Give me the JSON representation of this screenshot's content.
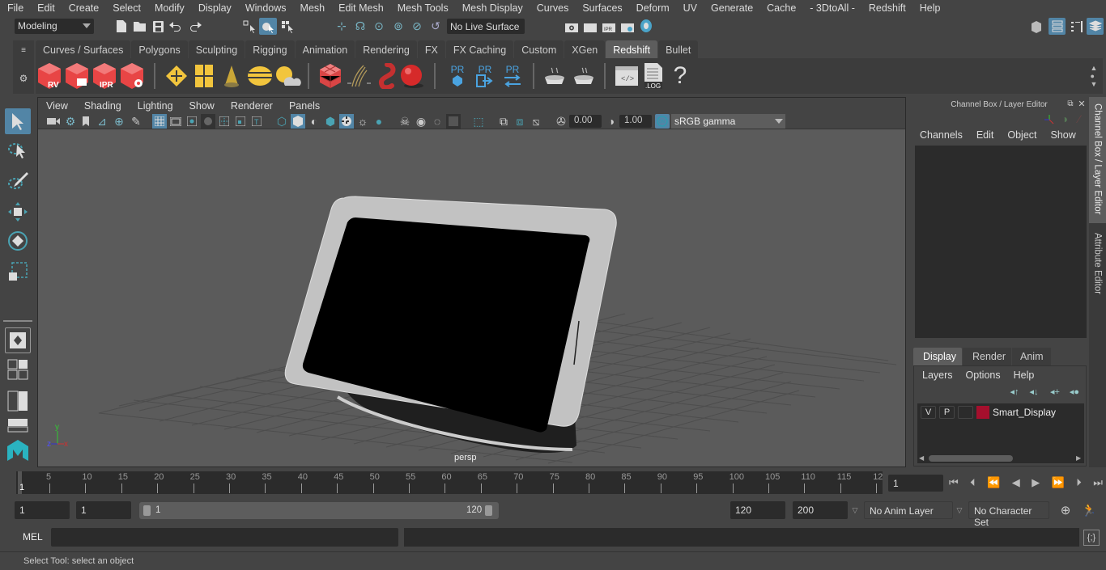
{
  "menu": [
    "File",
    "Edit",
    "Create",
    "Select",
    "Modify",
    "Display",
    "Windows",
    "Mesh",
    "Edit Mesh",
    "Mesh Tools",
    "Mesh Display",
    "Curves",
    "Surfaces",
    "Deform",
    "UV",
    "Generate",
    "Cache",
    "- 3DtoAll -",
    "Redshift",
    "Help"
  ],
  "status_line": {
    "mode": "Modeling",
    "live_surface": "No Live Surface"
  },
  "shelf": {
    "tabs": [
      "Curves / Surfaces",
      "Polygons",
      "Sculpting",
      "Rigging",
      "Animation",
      "Rendering",
      "FX",
      "FX Caching",
      "Custom",
      "XGen",
      "Redshift",
      "Bullet"
    ],
    "active_tab": "Redshift",
    "icons": [
      "rv-render-icon",
      "batch-render-icon",
      "ipr-render-icon",
      "render-settings-icon",
      "area-light-icon",
      "portal-light-icon",
      "spot-light-icon",
      "dome-light-icon",
      "sun-sky-icon",
      "proxy-cube-icon",
      "hair-icon",
      "volume-icon",
      "sphere-material-icon",
      "pr-proxy-icon",
      "pr-export-icon",
      "pr-swap-icon",
      "baking-icon",
      "baking-options-icon",
      "script-editor-icon",
      "log-icon",
      "help-icon"
    ],
    "icon_labels": {
      "rv": "RV",
      "ipr": "IPR",
      "pr": "PR",
      "log": ".LOG",
      "help": "?"
    }
  },
  "viewport": {
    "menu": [
      "View",
      "Shading",
      "Lighting",
      "Show",
      "Renderer",
      "Panels"
    ],
    "exposure": "0.00",
    "gamma": "1.00",
    "color_mgmt": "ON",
    "color_space": "sRGB gamma",
    "camera_label": "persp",
    "axis": {
      "x": "x",
      "y": "y",
      "z": "z"
    }
  },
  "channel_box": {
    "title": "Channel Box / Layer Editor",
    "menu": [
      "Channels",
      "Edit",
      "Object",
      "Show"
    ],
    "layer_tabs": [
      "Display",
      "Render",
      "Anim"
    ],
    "active_layer_tab": "Display",
    "layer_menu": [
      "Layers",
      "Options",
      "Help"
    ],
    "layers": [
      {
        "v": "V",
        "p": "P",
        "color": "#a50f2d",
        "name": "Smart_Display"
      }
    ]
  },
  "side_tabs": [
    "Channel Box / Layer Editor",
    "Attribute Editor"
  ],
  "timeline": {
    "ticks": [
      "5",
      "10",
      "15",
      "20",
      "25",
      "30",
      "35",
      "40",
      "45",
      "50",
      "55",
      "60",
      "65",
      "70",
      "75",
      "80",
      "85",
      "90",
      "95",
      "100",
      "105",
      "110",
      "115",
      "12"
    ],
    "current_frame_marker": "1",
    "current_frame": "1"
  },
  "range": {
    "start": "1",
    "playback_start": "1",
    "slider_start": "1",
    "slider_end": "120",
    "playback_end": "120",
    "end": "200",
    "anim_layer": "No Anim Layer",
    "character_set": "No Character Set"
  },
  "command_line": {
    "label": "MEL",
    "value": ""
  },
  "help_line": "Select Tool: select an object"
}
